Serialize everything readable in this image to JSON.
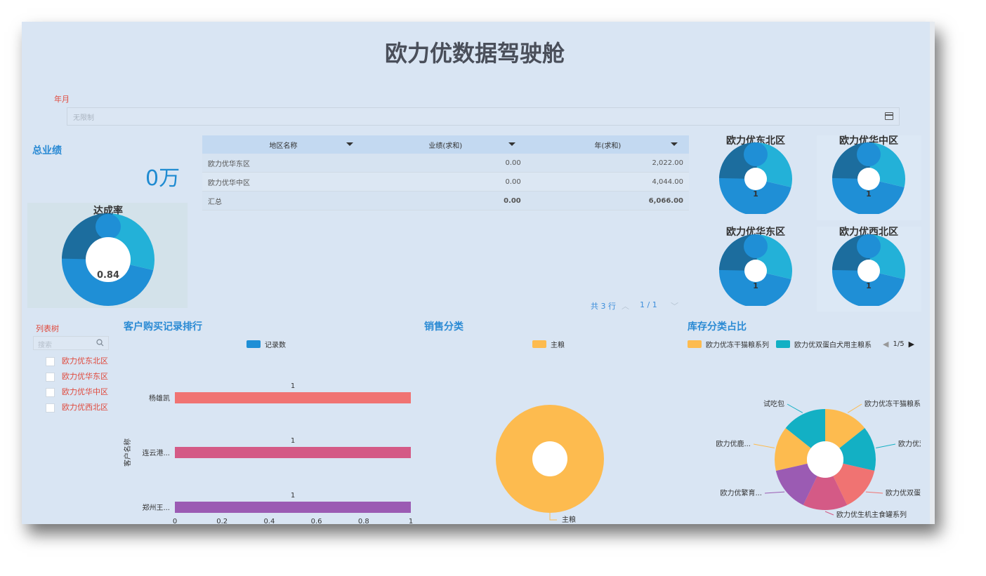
{
  "title": "欧力优数据驾驶舱",
  "filter": {
    "label": "年月",
    "placeholder": "无限制"
  },
  "total": {
    "title": "总业绩",
    "value": "0万"
  },
  "achievement": {
    "title": "达成率",
    "value": "0.84"
  },
  "region_table": {
    "headers": [
      "地区名称",
      "业绩(求和)",
      "年(求和)"
    ],
    "rows": [
      [
        "欧力优华东区",
        "0.00",
        "2,022.00"
      ],
      [
        "欧力优华中区",
        "0.00",
        "4,044.00"
      ]
    ],
    "total_row": [
      "汇总",
      "0.00",
      "6,066.00"
    ],
    "pager_count": "共 3 行",
    "pager_page": "1 / 1"
  },
  "region_donuts": [
    {
      "title": "欧力优东北区",
      "value": "1"
    },
    {
      "title": "欧力优华中区",
      "value": "1"
    },
    {
      "title": "欧力优华东区",
      "value": "1"
    },
    {
      "title": "欧力优西北区",
      "value": "1"
    }
  ],
  "tree": {
    "title": "列表树",
    "search_placeholder": "搜索",
    "items": [
      "欧力优东北区",
      "欧力优华东区",
      "欧力优华中区",
      "欧力优西北区"
    ]
  },
  "icons": {
    "search": "search-icon",
    "calendar": "calendar-icon",
    "dropdown": "caret-down-icon",
    "pager_prev": "chevron-up-icon",
    "pager_next": "chevron-down-icon",
    "legend_prev": "triangle-left-icon",
    "legend_next": "triangle-right-icon"
  },
  "colors": {
    "accent": "#2a8ad4",
    "donut_main": "#1f8fd6",
    "donut_light": "#23b1d8",
    "donut_dark": "#1c6d9e",
    "filter_label": "#e0493c"
  },
  "chart_data": [
    {
      "type": "bar",
      "title": "客户购买记录排行",
      "orientation": "horizontal",
      "categories": [
        "杨雄凯",
        "连云港...",
        "郑州王..."
      ],
      "series": [
        {
          "name": "记录数",
          "values": [
            1,
            1,
            1
          ]
        }
      ],
      "colors": [
        "#f07372",
        "#d45a86",
        "#9b5bb3"
      ],
      "ylabel": "客户名称",
      "xlim": [
        0,
        1
      ],
      "xticks": [
        "0",
        "0.2",
        "0.4",
        "0.6",
        "0.8",
        "1"
      ],
      "data_labels": [
        "1",
        "1",
        "1"
      ],
      "legend": "top-center"
    },
    {
      "type": "pie",
      "title": "销售分类",
      "slices": [
        {
          "label": "主粮",
          "value": 1,
          "color": "#fdbb4f"
        }
      ],
      "legend": [
        "主粮"
      ]
    },
    {
      "type": "pie",
      "title": "库存分类占比",
      "legend": [
        "欧力优冻干猫粮系列",
        "欧力优双蛋白犬用主粮系"
      ],
      "legend_pager": "1/5",
      "slices": [
        {
          "label": "欧力优冻干猫粮系列",
          "value": 1,
          "color": "#fdbb4f"
        },
        {
          "label": "欧力优双...",
          "value": 1,
          "color": "#13b0c4"
        },
        {
          "label": "欧力优双蛋...",
          "value": 1,
          "color": "#f07372"
        },
        {
          "label": "欧力优生机主食罐系列",
          "value": 1,
          "color": "#d45a86"
        },
        {
          "label": "欧力优繁育...",
          "value": 1,
          "color": "#9b5bb3"
        },
        {
          "label": "欧力优鹿...",
          "value": 1,
          "color": "#fdbb4f"
        },
        {
          "label": "试吃包",
          "value": 1,
          "color": "#13b0c4"
        }
      ]
    }
  ]
}
